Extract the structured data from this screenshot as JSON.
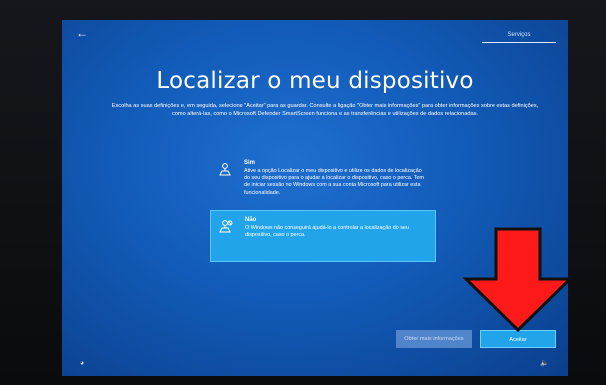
{
  "step": {
    "label": "Serviços"
  },
  "page": {
    "title": "Localizar o meu dispositivo",
    "subtitle": "Escolha as suas definições e, em seguida, selecione \"Aceitar\" para as guardar. Consulte a ligação \"Obter mais informações\" para obter informações sobre estas definições, como alterá-las, como o Microsoft Defender SmartScreen funciona e as transferências e utilizações de dados relacionadas."
  },
  "options": [
    {
      "title": "Sim",
      "description": "Ative a opção Localizar o meu dispositivo e utilize os dados de localização do seu dispositivo para o ajudar a localizar o dispositivo, caso o perca. Tem de iniciar sessão no Windows com a sua conta Microsoft para utilizar esta funcionalidade.",
      "selected": false,
      "icon": "location-person-icon"
    },
    {
      "title": "Não",
      "description": "O Windows não conseguirá ajudá-lo a controlar a localização do seu dispositivo, caso o perca.",
      "selected": true,
      "icon": "location-person-off-icon"
    }
  ],
  "buttons": {
    "more_info": "Obter mais informações",
    "accept": "Aceitar"
  },
  "colors": {
    "screen_blue": "#125bb8",
    "selected_option": "#22a4ea",
    "annotation_arrow": "#ff1a1a"
  }
}
